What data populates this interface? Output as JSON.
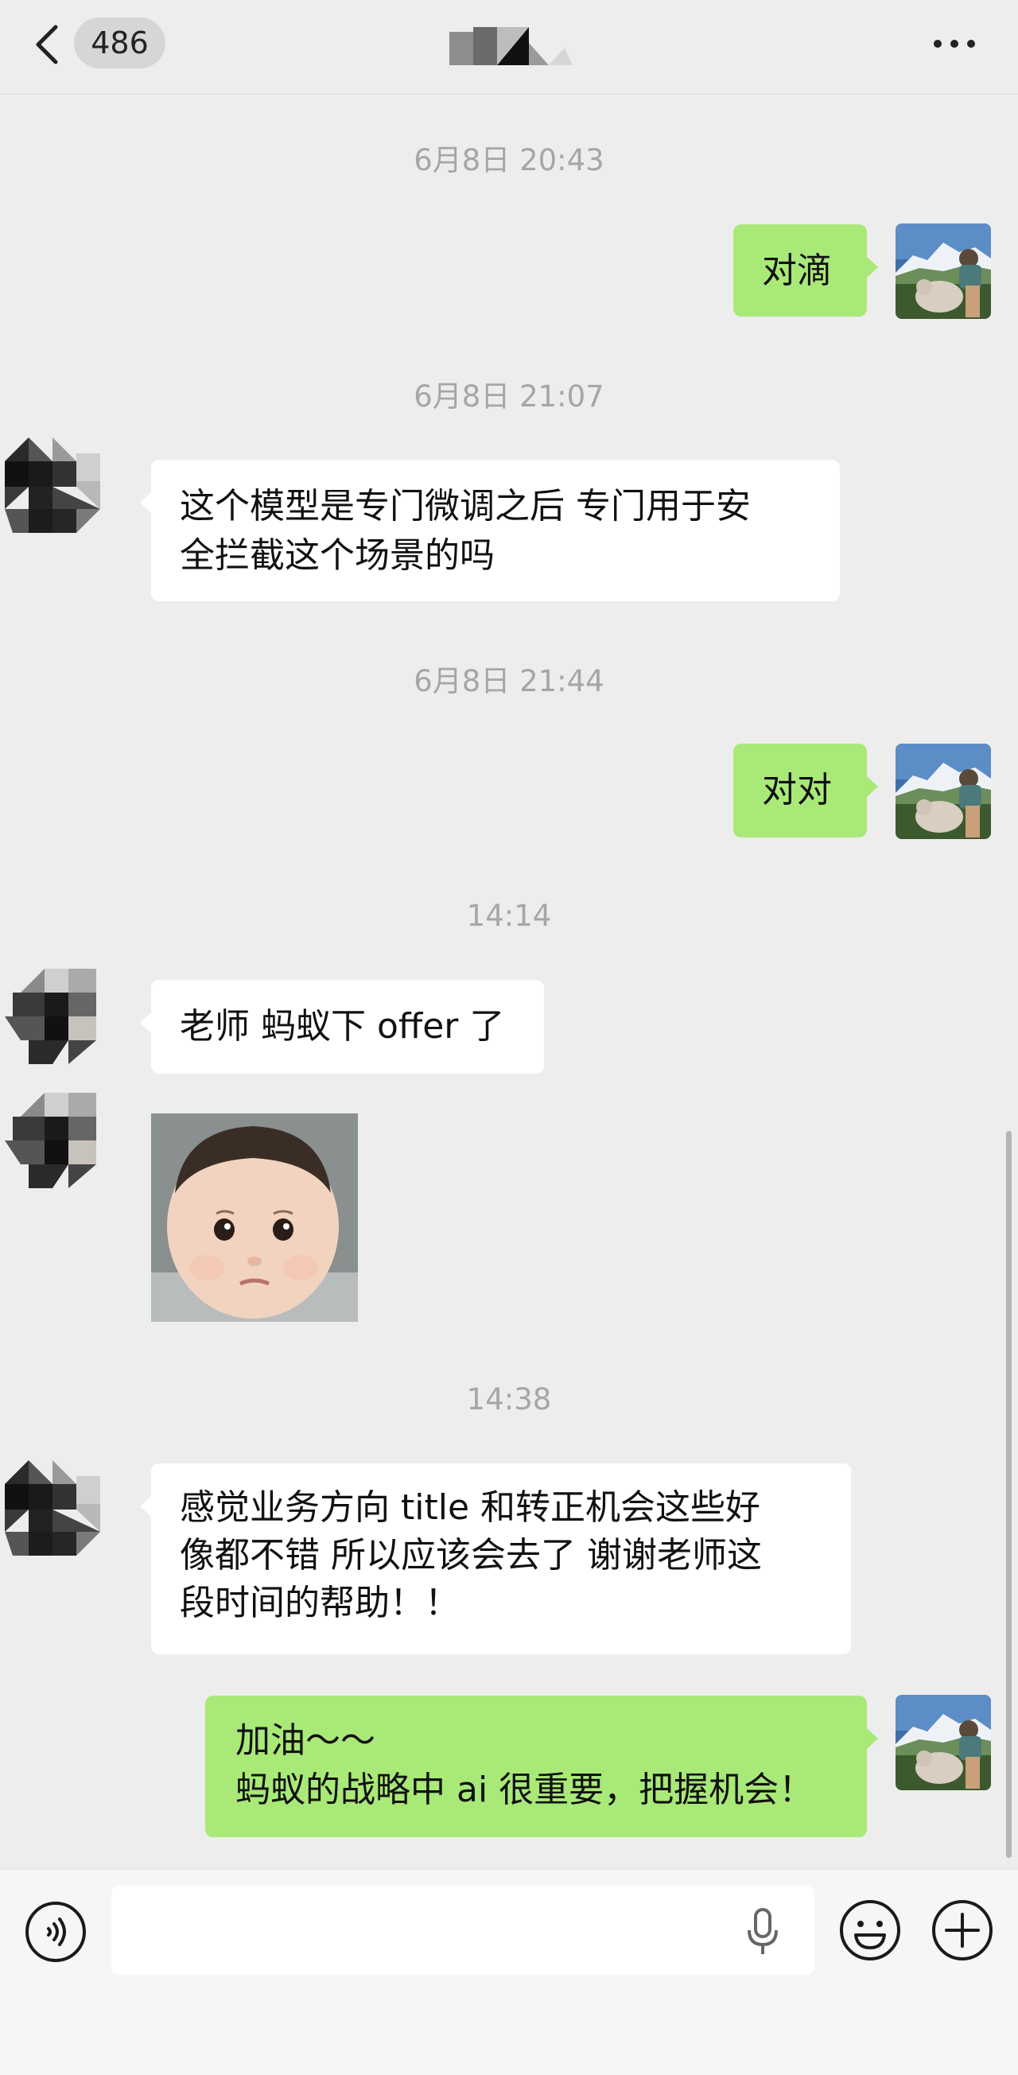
{
  "header": {
    "unread_count": "486",
    "back_icon": "chevron-left-icon",
    "more_icon": "ellipsis-icon"
  },
  "messages": {
    "ts1": "6月8日 20:43",
    "m1": "对滴",
    "ts2": "6月8日 21:07",
    "m2": "这个模型是专门微调之后 专门用于安\n全拦截这个场景的吗",
    "ts3": "6月8日 21:44",
    "m3": "对对",
    "ts4": "14:14",
    "m4": "老师 蚂蚁下 offer 了",
    "ts5": "14:38",
    "m5": "感觉业务方向 title 和转正机会这些好\n像都不错 所以应该会去了 谢谢老师这\n段时间的帮助！！",
    "m6": "加油～～\n蚂蚁的战略中 ai 很重要，把握机会！"
  },
  "input_bar": {
    "value": "",
    "voice_icon": "voice-mode-icon",
    "mic_icon": "microphone-icon",
    "emoji_icon": "emoji-icon",
    "plus_icon": "plus-icon"
  },
  "colors": {
    "background": "#ededed",
    "bubble_out": "#a9e978",
    "bubble_in": "#ffffff",
    "timestamp": "#a6a6a6"
  }
}
